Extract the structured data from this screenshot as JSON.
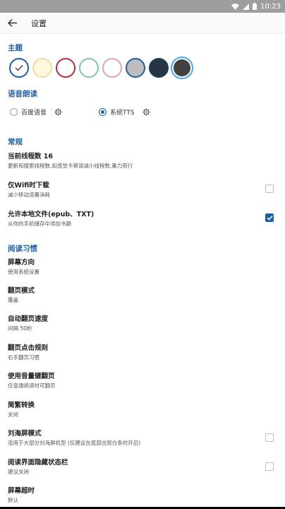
{
  "status": {
    "time": "10:23"
  },
  "toolbar": {
    "title": "设置"
  },
  "sections": {
    "theme": "主题",
    "tts": "语音朗读",
    "general": "常规",
    "reading": "阅读习惯"
  },
  "theme_colors": [
    {
      "fill": "#ffffff",
      "selected": true
    },
    {
      "fill": "#fff8e1",
      "selected": false
    },
    {
      "fill": "#ffffff",
      "selected": false
    },
    {
      "fill": "#ffffff",
      "selected": false
    },
    {
      "fill": "#ffffff",
      "selected": false
    },
    {
      "fill": "#bdbdbd",
      "selected": false
    },
    {
      "fill": "#263544",
      "selected": false
    },
    {
      "fill": "#424242",
      "selected": false
    }
  ],
  "tts": {
    "baidu": "百度语音",
    "system": "系统TTS",
    "selected": "system"
  },
  "general": {
    "threads_title": "当前线程数 16",
    "threads_summary": "更新和搜索线程数,如感觉卡顿请减小线程数,量力而行",
    "wifi_title": "仅Wifi时下载",
    "wifi_summary": "减少移动流量消耗",
    "wifi_checked": false,
    "local_title": "允许本地文件(epub、TXT)",
    "local_summary": "从你的手机储存中添加书籍",
    "local_checked": true
  },
  "reading": {
    "orientation_title": "屏幕方向",
    "orientation_summary": "使用系统设置",
    "flip_mode_title": "翻页模式",
    "flip_mode_summary": "覆盖",
    "auto_speed_title": "自动翻页速度",
    "auto_speed_summary": "间隔 50秒",
    "click_rule_title": "翻页点击规则",
    "click_rule_summary": "右手翻页习惯",
    "volume_title": "使用音量键翻页",
    "volume_summary": "仅音通阅读时可翻页",
    "convert_title": "简繁转换",
    "convert_summary": "关闭",
    "notch_title": "刘海屏模式",
    "notch_summary": "适用于大部分刘海屏机型 (仅建议在底部出现白条时开启)",
    "notch_checked": false,
    "hide_status_title": "阅读界面隐藏状态栏",
    "hide_status_summary": "建议关闭",
    "hide_status_checked": false,
    "timeout_title": "屏幕超时",
    "timeout_summary": "默认"
  }
}
